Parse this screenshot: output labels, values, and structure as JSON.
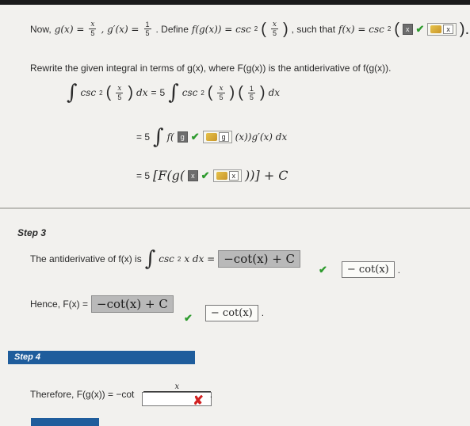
{
  "intro": {
    "now": "Now,",
    "gx": "g(x) =",
    "gx_frac_num": "x",
    "gx_frac_den": "5",
    "gprime": ", g′(x) =",
    "gprime_frac_num": "1",
    "gprime_frac_den": "5",
    "define": ". Define",
    "fg": "f(g(x)) = csc",
    "sup2": "2",
    "fg_frac_num": "x",
    "fg_frac_den": "5",
    "such_that": ", such that",
    "fx": "f(x) = csc",
    "input_value": "x",
    "input_key_value": "x",
    "close": ")."
  },
  "rewrite": {
    "text": "Rewrite the given integral in terms of g(x), where F(g(x)) is the antiderivative of f(g(x))."
  },
  "eq1": {
    "lhs": "csc",
    "lhs_sup": "2",
    "frac_num": "x",
    "frac_den": "5",
    "dx": "dx",
    "equals": "=",
    "coef": "5",
    "rhs": "csc",
    "rhs_sup": "2",
    "rhs_frac_num": "x",
    "rhs_frac_den": "5",
    "rhs_frac2_num": "1",
    "rhs_frac2_den": "5"
  },
  "eq2": {
    "prefix": "= 5",
    "f_open": "f(",
    "input_value": "g",
    "key_value": "g",
    "suffix": "(x))g′(x) dx"
  },
  "eq3": {
    "prefix": "= 5",
    "open": "[F(g(",
    "input_value": "x",
    "key_value": "x",
    "close": "))] + C"
  },
  "step3": {
    "label": "Step 3",
    "text": "The antiderivative of f(x) is",
    "integrand": "csc",
    "integrand_sup": "2",
    "integrand_rest": "x dx =",
    "answer": "−cot(x) + C",
    "key_answer": "− cot(x)"
  },
  "hence": {
    "text": "Hence, F(x) =",
    "answer": "−cot(x) + C",
    "key_answer": "− cot(x)"
  },
  "step4": {
    "label": "Step 4",
    "therefore": "Therefore, F(g(x)) = −cot",
    "frac_num": "x"
  },
  "colors": {
    "check": "#2e9b2e",
    "cross": "#d12020",
    "step4_bar": "#1f5d9c"
  }
}
